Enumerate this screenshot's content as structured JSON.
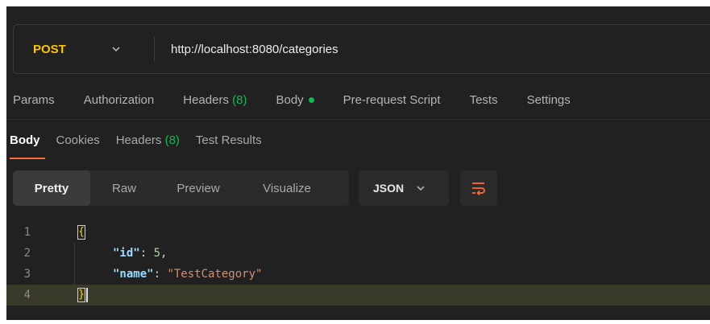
{
  "request": {
    "method": "POST",
    "url": "http://localhost:8080/categories"
  },
  "request_tabs": {
    "params": "Params",
    "authorization": "Authorization",
    "headers_label": "Headers",
    "headers_count": "(8)",
    "body": "Body",
    "pre_request": "Pre-request Script",
    "tests": "Tests",
    "settings": "Settings"
  },
  "response_tabs": {
    "body": "Body",
    "cookies": "Cookies",
    "headers_label": "Headers",
    "headers_count": "(8)",
    "test_results": "Test Results"
  },
  "toolbar": {
    "pretty": "Pretty",
    "raw": "Raw",
    "preview": "Preview",
    "visualize": "Visualize",
    "format": "JSON"
  },
  "code": {
    "lines": [
      {
        "n": "1"
      },
      {
        "n": "2",
        "key": "\"id\"",
        "sep": ": ",
        "value": "5",
        "end": ","
      },
      {
        "n": "3",
        "key": "\"name\"",
        "sep": ": ",
        "value": "\"TestCategory\""
      },
      {
        "n": "4"
      }
    ]
  },
  "colors": {
    "method": "#ffc500",
    "accent": "#ff6c37",
    "success": "#0cbb52"
  },
  "icons": {
    "method_dropdown": "chevron-down-icon",
    "format_dropdown": "chevron-down-icon",
    "wrap": "wrap-lines-icon"
  }
}
